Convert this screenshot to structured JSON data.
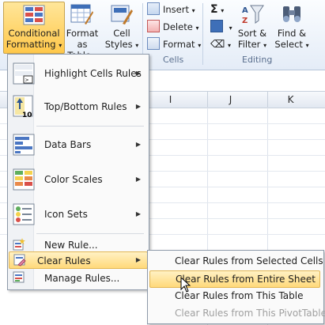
{
  "ribbon": {
    "conditional_formatting": {
      "line1": "Conditional",
      "line2": "Formatting"
    },
    "format_as_table": {
      "line1": "Format",
      "line2": "as Table"
    },
    "cell_styles": {
      "line1": "Cell",
      "line2": "Styles"
    },
    "cells_group": {
      "insert": "Insert",
      "delete": "Delete",
      "format": "Format",
      "label": "Cells"
    },
    "editing_group": {
      "sort_filter": {
        "line1": "Sort &",
        "line2": "Filter"
      },
      "find_select": {
        "line1": "Find &",
        "line2": "Select"
      },
      "label": "Editing"
    }
  },
  "columns": [
    "I",
    "J",
    "K"
  ],
  "menu": {
    "items": [
      {
        "label": "Highlight Cells Rules",
        "icon": "highlight-cells-icon"
      },
      {
        "label": "Top/Bottom Rules",
        "icon": "top-bottom-icon"
      },
      {
        "label": "Data Bars",
        "icon": "data-bars-icon"
      },
      {
        "label": "Color Scales",
        "icon": "color-scales-icon"
      },
      {
        "label": "Icon Sets",
        "icon": "icon-sets-icon"
      },
      {
        "label": "New Rule...",
        "icon": "new-rule-icon"
      },
      {
        "label": "Clear Rules",
        "icon": "clear-rules-icon"
      },
      {
        "label": "Manage Rules...",
        "icon": "manage-rules-icon"
      }
    ]
  },
  "submenu": {
    "items": [
      {
        "label": "Clear Rules from Selected Cells",
        "enabled": true
      },
      {
        "label": "Clear Rules from Entire Sheet",
        "enabled": true
      },
      {
        "label": "Clear Rules from This Table",
        "enabled": true
      },
      {
        "label": "Clear Rules from This PivotTable",
        "enabled": false
      }
    ]
  },
  "colors": {
    "highlight": "#ffd97a",
    "ribbon": "#e4ecf7",
    "disabled_text": "#a0a0a0"
  }
}
